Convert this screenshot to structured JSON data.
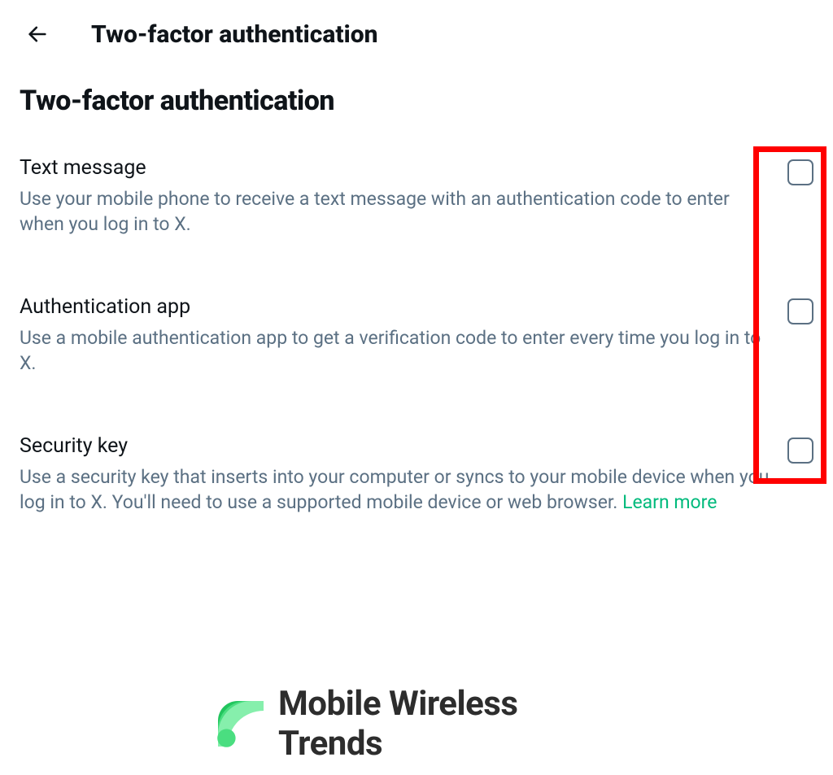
{
  "header": {
    "title": "Two-factor authentication"
  },
  "section": {
    "heading": "Two-factor authentication"
  },
  "options": [
    {
      "title": "Text message",
      "description": "Use your mobile phone to receive a text message with an authentication code to enter when you log in to X."
    },
    {
      "title": "Authentication app",
      "description": "Use a mobile authentication app to get a verification code to enter every time you log in to X."
    },
    {
      "title": "Security key",
      "description": "Use a security key that inserts into your computer or syncs to your mobile device when you log in to X. You'll need to use a supported mobile device or web browser. ",
      "learn_more": "Learn more"
    }
  ],
  "footer": {
    "brand": "Mobile Wireless Trends"
  }
}
